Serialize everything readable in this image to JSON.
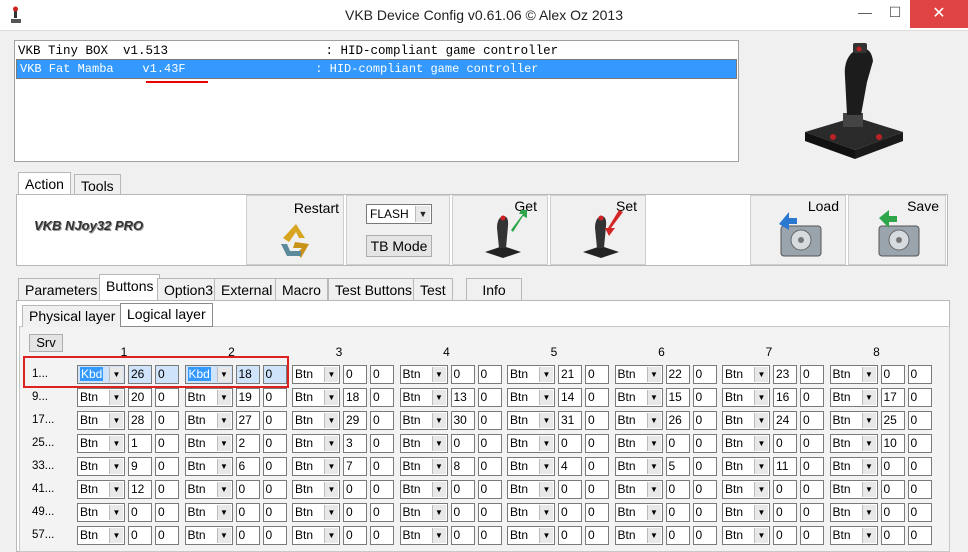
{
  "window": {
    "title": "VKB Device Config v0.61.06 © Alex Oz 2013",
    "min_glyph": "—",
    "max_glyph": "☐",
    "close_glyph": "✕"
  },
  "devices": [
    {
      "text": "VKB Tiny BOX  v1.513                     : HID-compliant game controller",
      "selected": false
    },
    {
      "text": "VKB Fat Mamba    v1.43F                  : HID-compliant game controller",
      "selected": true
    }
  ],
  "tabs_top": [
    "Action",
    "Tools"
  ],
  "brand": "VKB NJoy32 PRO",
  "toolbar": {
    "restart": "Restart",
    "flash_select": "FLASH",
    "tb_mode": "TB Mode",
    "get": "Get",
    "set": "Set",
    "load": "Load",
    "save": "Save"
  },
  "tabs_main": [
    "Parameters",
    "Buttons",
    "Option3",
    "External",
    "Macro",
    "Test Buttons",
    "Test",
    "Info"
  ],
  "tabs_sub": [
    "Physical layer",
    "Logical layer"
  ],
  "srv": "Srv",
  "groups": [
    "1",
    "2",
    "3",
    "4",
    "5",
    "6",
    "7",
    "8"
  ],
  "rows": [
    {
      "label": "1...",
      "cells": [
        [
          "Kbd",
          "26",
          "0"
        ],
        [
          "Kbd",
          "18",
          "0"
        ],
        [
          "Btn",
          "0",
          "0"
        ],
        [
          "Btn",
          "0",
          "0"
        ],
        [
          "Btn",
          "21",
          "0"
        ],
        [
          "Btn",
          "22",
          "0"
        ],
        [
          "Btn",
          "23",
          "0"
        ],
        [
          "Btn",
          "0",
          "0"
        ]
      ]
    },
    {
      "label": "9...",
      "cells": [
        [
          "Btn",
          "20",
          "0"
        ],
        [
          "Btn",
          "19",
          "0"
        ],
        [
          "Btn",
          "18",
          "0"
        ],
        [
          "Btn",
          "13",
          "0"
        ],
        [
          "Btn",
          "14",
          "0"
        ],
        [
          "Btn",
          "15",
          "0"
        ],
        [
          "Btn",
          "16",
          "0"
        ],
        [
          "Btn",
          "17",
          "0"
        ]
      ]
    },
    {
      "label": "17...",
      "cells": [
        [
          "Btn",
          "28",
          "0"
        ],
        [
          "Btn",
          "27",
          "0"
        ],
        [
          "Btn",
          "29",
          "0"
        ],
        [
          "Btn",
          "30",
          "0"
        ],
        [
          "Btn",
          "31",
          "0"
        ],
        [
          "Btn",
          "26",
          "0"
        ],
        [
          "Btn",
          "24",
          "0"
        ],
        [
          "Btn",
          "25",
          "0"
        ]
      ]
    },
    {
      "label": "25...",
      "cells": [
        [
          "Btn",
          "1",
          "0"
        ],
        [
          "Btn",
          "2",
          "0"
        ],
        [
          "Btn",
          "3",
          "0"
        ],
        [
          "Btn",
          "0",
          "0"
        ],
        [
          "Btn",
          "0",
          "0"
        ],
        [
          "Btn",
          "0",
          "0"
        ],
        [
          "Btn",
          "0",
          "0"
        ],
        [
          "Btn",
          "10",
          "0"
        ]
      ]
    },
    {
      "label": "33...",
      "cells": [
        [
          "Btn",
          "9",
          "0"
        ],
        [
          "Btn",
          "6",
          "0"
        ],
        [
          "Btn",
          "7",
          "0"
        ],
        [
          "Btn",
          "8",
          "0"
        ],
        [
          "Btn",
          "4",
          "0"
        ],
        [
          "Btn",
          "5",
          "0"
        ],
        [
          "Btn",
          "11",
          "0"
        ],
        [
          "Btn",
          "0",
          "0"
        ]
      ]
    },
    {
      "label": "41...",
      "cells": [
        [
          "Btn",
          "12",
          "0"
        ],
        [
          "Btn",
          "0",
          "0"
        ],
        [
          "Btn",
          "0",
          "0"
        ],
        [
          "Btn",
          "0",
          "0"
        ],
        [
          "Btn",
          "0",
          "0"
        ],
        [
          "Btn",
          "0",
          "0"
        ],
        [
          "Btn",
          "0",
          "0"
        ],
        [
          "Btn",
          "0",
          "0"
        ]
      ]
    },
    {
      "label": "49...",
      "cells": [
        [
          "Btn",
          "0",
          "0"
        ],
        [
          "Btn",
          "0",
          "0"
        ],
        [
          "Btn",
          "0",
          "0"
        ],
        [
          "Btn",
          "0",
          "0"
        ],
        [
          "Btn",
          "0",
          "0"
        ],
        [
          "Btn",
          "0",
          "0"
        ],
        [
          "Btn",
          "0",
          "0"
        ],
        [
          "Btn",
          "0",
          "0"
        ]
      ]
    },
    {
      "label": "57...",
      "cells": [
        [
          "Btn",
          "0",
          "0"
        ],
        [
          "Btn",
          "0",
          "0"
        ],
        [
          "Btn",
          "0",
          "0"
        ],
        [
          "Btn",
          "0",
          "0"
        ],
        [
          "Btn",
          "0",
          "0"
        ],
        [
          "Btn",
          "0",
          "0"
        ],
        [
          "Btn",
          "0",
          "0"
        ],
        [
          "Btn",
          "0",
          "0"
        ]
      ]
    }
  ],
  "icons": {
    "app": "joystick-icon",
    "restart": "recycle-icon",
    "get": "joystick-get-icon",
    "set": "joystick-set-icon",
    "load": "disk-load-icon",
    "save": "disk-save-icon"
  }
}
